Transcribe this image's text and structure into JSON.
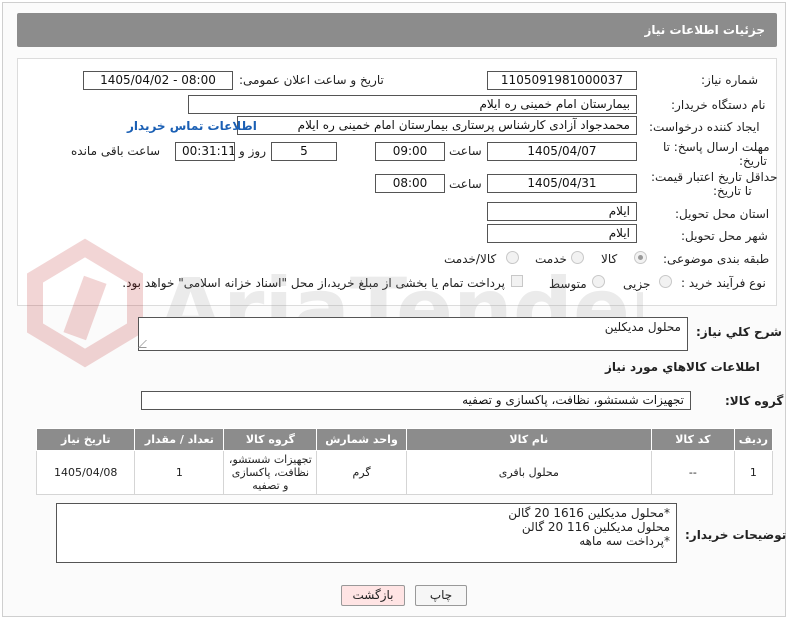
{
  "header": {
    "title": "جزئیات اطلاعات نیاز"
  },
  "form": {
    "need_number_label": "شماره نیاز:",
    "need_number": "1105091981000037",
    "announce_label": "تاریخ و ساعت اعلان عمومی:",
    "announce_value": "1405/04/02 - 08:00",
    "buyer_org_label": "نام دستگاه خریدار:",
    "buyer_org": "بیمارستان امام خمینی  ره  ایلام",
    "creator_label": "ایجاد کننده درخواست:",
    "creator": "محمدجواد آزادی کارشناس پرستاری بیمارستان امام خمینی  ره  ایلام",
    "contact_link": "اطلاعات تماس خریدار",
    "deadline_label_1": "مهلت ارسال پاسخ: تا",
    "deadline_label_2": "تاریخ:",
    "deadline_date": "1405/04/07",
    "time_label": "ساعت",
    "deadline_time": "09:00",
    "days_value": "5",
    "days_label": "روز و",
    "remaining_time": "00:31:11",
    "remaining_label": "ساعت باقی مانده",
    "price_validity_label_1": "حداقل تاریخ اعتبار قیمت:",
    "price_validity_label_2": "تا تاریخ:",
    "price_validity_date": "1405/04/31",
    "price_validity_time": "08:00",
    "province_label": "استان محل تحویل:",
    "province": "ایلام",
    "city_label": "شهر محل تحویل:",
    "city": "ایلام",
    "category_label": "طبقه بندی موضوعی:",
    "category_options": [
      "کالا",
      "خدمت",
      "کالا/خدمت"
    ],
    "purchase_type_label": "نوع فرآیند خرید :",
    "purchase_options": [
      "جزیی",
      "متوسط"
    ],
    "payment_note": "پرداخت تمام یا بخشی از مبلغ خرید،از محل \"اسناد خزانه اسلامی\" خواهد بود."
  },
  "summary": {
    "label": "شرح کلي نياز:",
    "value": "محلول مديکلين"
  },
  "goods_section": {
    "title": "اطلاعات کالاهاي مورد نياز",
    "group_label": "گروه کالا:",
    "group_value": "تجهیزات شستشو، نظافت، پاکسازی و تصفیه"
  },
  "table": {
    "headers": [
      "رديف",
      "کد کالا",
      "نام کالا",
      "واحد شمارش",
      "گروه کالا",
      "تعداد / مقدار",
      "تاریخ نیاز"
    ],
    "rows": [
      [
        "1",
        "--",
        "محلول بافری",
        "گرم",
        "تجهیزات شستشو، نظافت، پاکسازی و تصفیه",
        "1",
        "1405/04/08"
      ]
    ]
  },
  "notes": {
    "label": "توضیحات خریدار:",
    "lines": [
      "*محلول مدیکلین 1616 20 گالن",
      "محلول مدیکلین 116 20 گالن",
      "*پرداخت سه ماهه"
    ]
  },
  "buttons": {
    "print": "چاپ",
    "back": "بازگشت"
  },
  "watermark": {
    "text": "AriaTender.neT"
  },
  "colors": {
    "header_bg": "#8c8c8c",
    "link": "#1a5fb4",
    "back_button_bg": "#ffe4e4"
  }
}
